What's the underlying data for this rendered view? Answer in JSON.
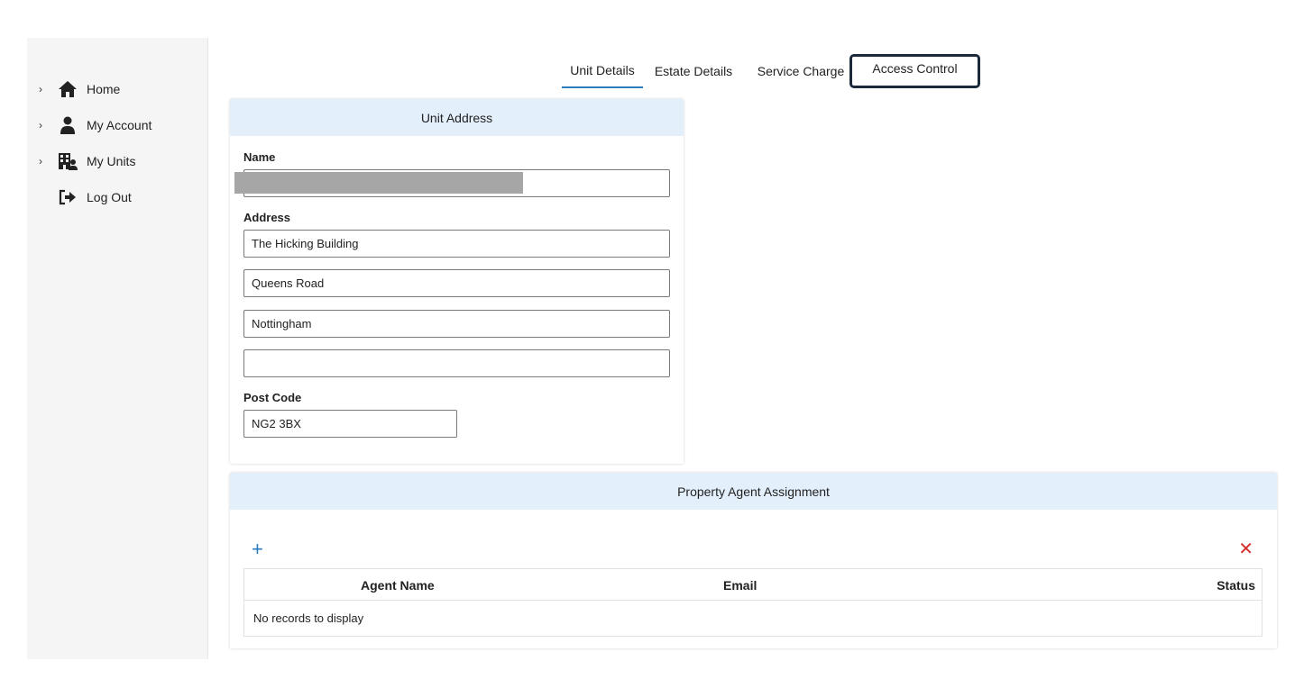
{
  "sidebar": {
    "items": [
      {
        "label": "Home",
        "icon": "home-icon",
        "has_chevron": true
      },
      {
        "label": "My Account",
        "icon": "user-icon",
        "has_chevron": true
      },
      {
        "label": "My Units",
        "icon": "building-user-icon",
        "has_chevron": true
      },
      {
        "label": "Log Out",
        "icon": "logout-icon",
        "has_chevron": false
      }
    ]
  },
  "tabs": [
    {
      "label": "Unit Details",
      "state": "active"
    },
    {
      "label": "Estate Details",
      "state": "normal"
    },
    {
      "label": "Service Charge",
      "state": "normal"
    },
    {
      "label": "Access Control",
      "state": "focused"
    }
  ],
  "unit_address": {
    "title": "Unit Address",
    "name_label": "Name",
    "name_value": "",
    "address_label": "Address",
    "address_lines": [
      "The Hicking Building",
      "Queens Road",
      "Nottingham",
      ""
    ],
    "postcode_label": "Post Code",
    "postcode_value": "NG2 3BX"
  },
  "agent_assignment": {
    "title": "Property Agent Assignment",
    "add_symbol": "+",
    "delete_symbol": "✕",
    "columns": [
      "Agent Name",
      "Email",
      "Status"
    ],
    "empty_text": "No records to display"
  },
  "colors": {
    "accent": "#2b7bbd",
    "header_bg": "#e3f0fb",
    "delete": "#d43030",
    "focus_ring": "#1a2a3a"
  }
}
